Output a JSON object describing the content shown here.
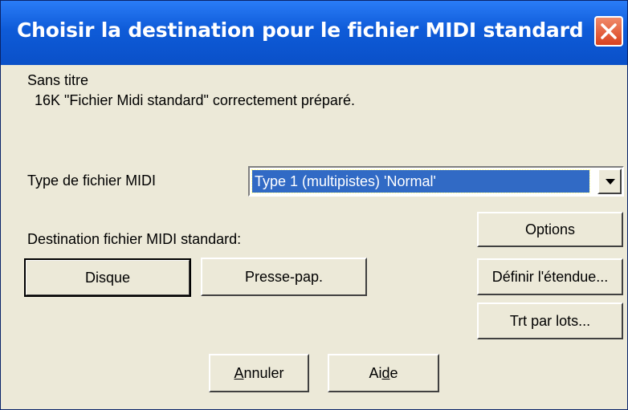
{
  "dialog": {
    "title": "Choisir la destination pour le fichier MIDI standard",
    "song_name": "Sans titre",
    "status_message": "16K \"Fichier Midi standard\" correctement préparé.",
    "file_type_label": "Type de fichier MIDI",
    "file_type_value": "Type 1 (multipistes) 'Normal'",
    "destination_label": "Destination fichier MIDI standard:"
  },
  "buttons": {
    "disk": "Disque",
    "clipboard": "Presse-pap.",
    "options": "Options",
    "define_range": "Définir l'étendue...",
    "batch": "Trt par lots...",
    "cancel_prefix": "",
    "cancel_underline": "A",
    "cancel_rest": "nnuler",
    "help_prefix": "Ai",
    "help_underline": "d",
    "help_rest": "e"
  },
  "icons": {
    "close": "close-icon",
    "dropdown": "chevron-down-icon"
  },
  "colors": {
    "titlebar": "#0e5bd8",
    "selection": "#316ac5",
    "dialog_bg": "#ece9d8"
  }
}
